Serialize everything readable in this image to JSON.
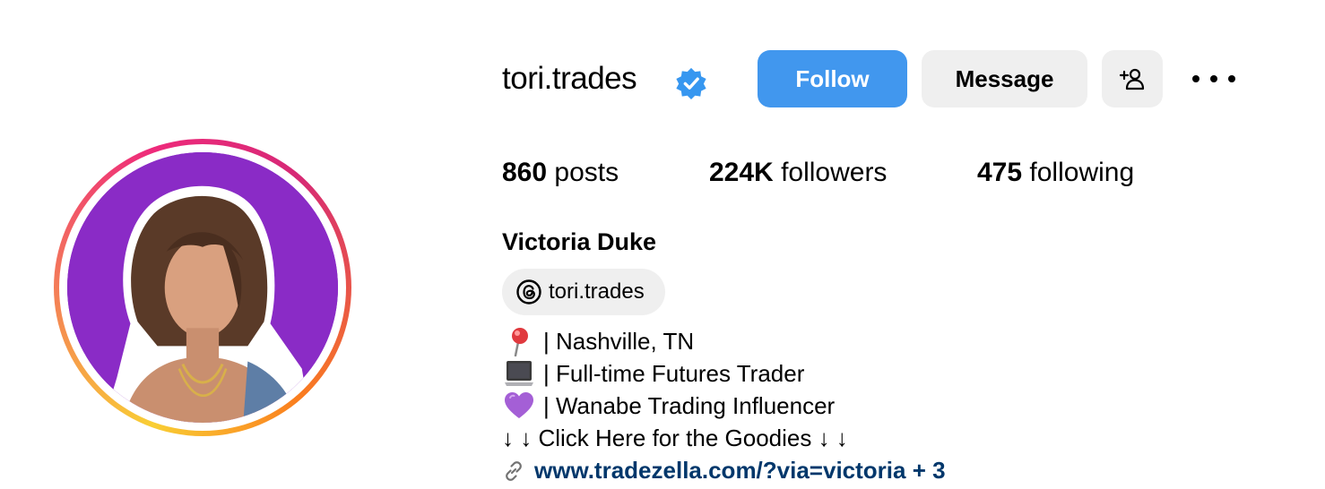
{
  "profile": {
    "username": "tori.trades",
    "verified": true,
    "full_name": "Victoria Duke",
    "threads_handle": "tori.trades",
    "avatar_bg_color": "#8a2bc6"
  },
  "actions": {
    "follow_label": "Follow",
    "message_label": "Message",
    "add_user_icon": "person-add-icon",
    "more_icon": "more-horizontal-icon"
  },
  "stats": {
    "posts_count": "860",
    "posts_label": "posts",
    "followers_count": "224K",
    "followers_label": "followers",
    "following_count": "475",
    "following_label": "following"
  },
  "bio": {
    "line1": "| Nashville, TN",
    "line1_icon": "round-pushpin-icon",
    "line2": "| Full-time Futures Trader",
    "line2_icon": "laptop-icon",
    "line3": "| Wanabe Trading Influencer",
    "line3_icon": "purple-heart-icon",
    "line4": "↓ ↓ Click Here for the Goodies ↓ ↓",
    "link_icon": "link-icon",
    "link_text": "www.tradezella.com/?via=victoria + 3"
  },
  "colors": {
    "follow_button": "#4197ee",
    "secondary_button": "#efefef",
    "link": "#00376b",
    "verified_badge": "#3797f0"
  }
}
